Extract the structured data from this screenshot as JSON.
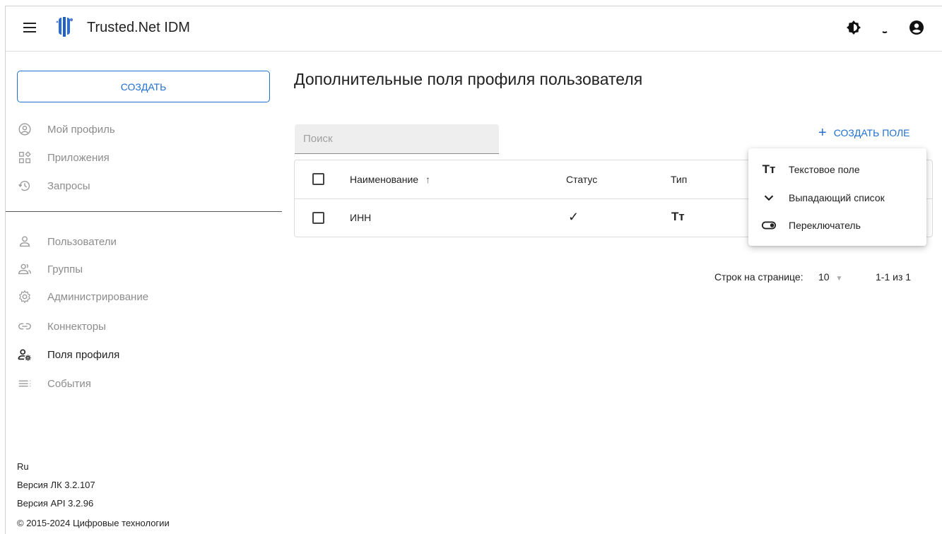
{
  "header": {
    "app_title": "Trusted.Net IDM"
  },
  "sidebar": {
    "create_label": "СОЗДАТЬ",
    "items_top": [
      {
        "label": "Мой профиль",
        "icon": "account-circle-icon"
      },
      {
        "label": "Приложения",
        "icon": "apps-icon"
      },
      {
        "label": "Запросы",
        "icon": "history-icon"
      }
    ],
    "items_bottom": [
      {
        "label": "Пользователи",
        "icon": "person-icon"
      },
      {
        "label": "Группы",
        "icon": "group-icon"
      },
      {
        "label": "Администрирование",
        "icon": "gear-icon"
      },
      {
        "label": "Коннекторы",
        "icon": "link-icon"
      },
      {
        "label": "Поля профиля",
        "icon": "person-settings-icon",
        "active": true
      },
      {
        "label": "События",
        "icon": "list-icon"
      }
    ],
    "footer": {
      "lang": "Ru",
      "version_lk": "Версия ЛК 3.2.107",
      "version_api": "Версия API 3.2.96",
      "copyright": "© 2015-2024 Цифровые технологии"
    }
  },
  "main": {
    "title": "Дополнительные поля профиля пользователя",
    "search_placeholder": "Поиск",
    "create_field_label": "СОЗДАТЬ ПОЛЕ",
    "table": {
      "columns": [
        "Наименование",
        "Статус",
        "Тип"
      ],
      "sort_indicator": "↑",
      "rows": [
        {
          "name": "ИНН",
          "status": "✓",
          "type": "Тт"
        }
      ]
    },
    "pager": {
      "rows_per_page_label": "Строк на странице:",
      "rows_per_page_value": "10",
      "range": "1-1 из 1"
    }
  },
  "popup_menu": {
    "items": [
      {
        "label": "Текстовое поле",
        "icon": "text-fields-icon"
      },
      {
        "label": "Выпадающий список",
        "icon": "chevron-down-icon"
      },
      {
        "label": "Переключатель",
        "icon": "toggle-icon"
      }
    ]
  },
  "colors": {
    "accent": "#1f6fd0",
    "muted_text": "#8c8c8c"
  }
}
